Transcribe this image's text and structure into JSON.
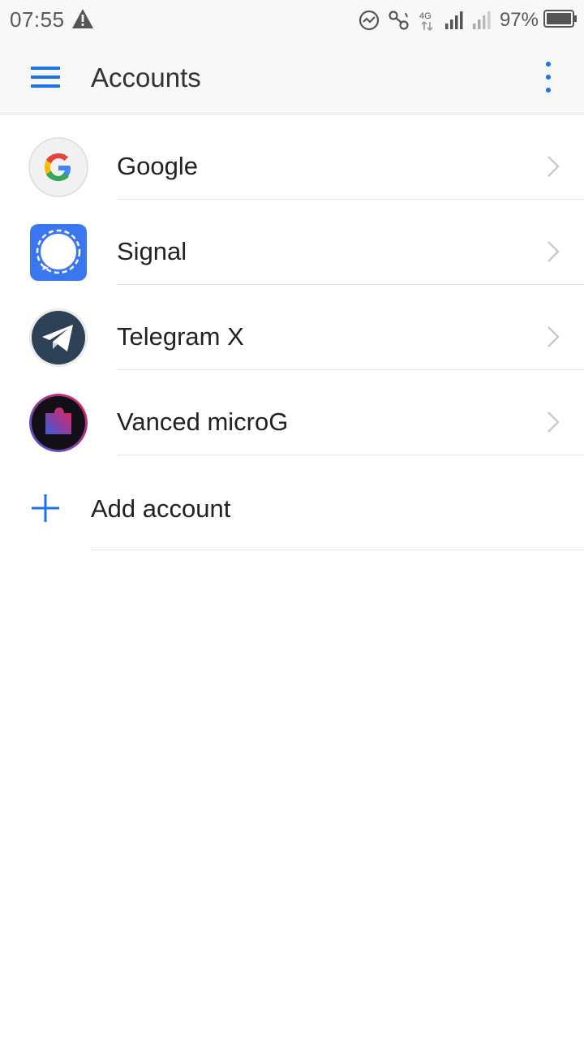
{
  "status_bar": {
    "time": "07:55",
    "battery_percent": "97%",
    "network_type": "4G"
  },
  "app_bar": {
    "title": "Accounts"
  },
  "accounts": [
    {
      "label": "Google",
      "icon": "google-icon"
    },
    {
      "label": "Signal",
      "icon": "signal-icon"
    },
    {
      "label": "Telegram X",
      "icon": "telegram-x-icon"
    },
    {
      "label": "Vanced microG",
      "icon": "vanced-microg-icon"
    }
  ],
  "add_account": {
    "label": "Add account",
    "icon": "plus-icon"
  },
  "colors": {
    "accent": "#1a73e8",
    "bar_background": "#f8f8f8",
    "divider": "#e3e3e3"
  }
}
